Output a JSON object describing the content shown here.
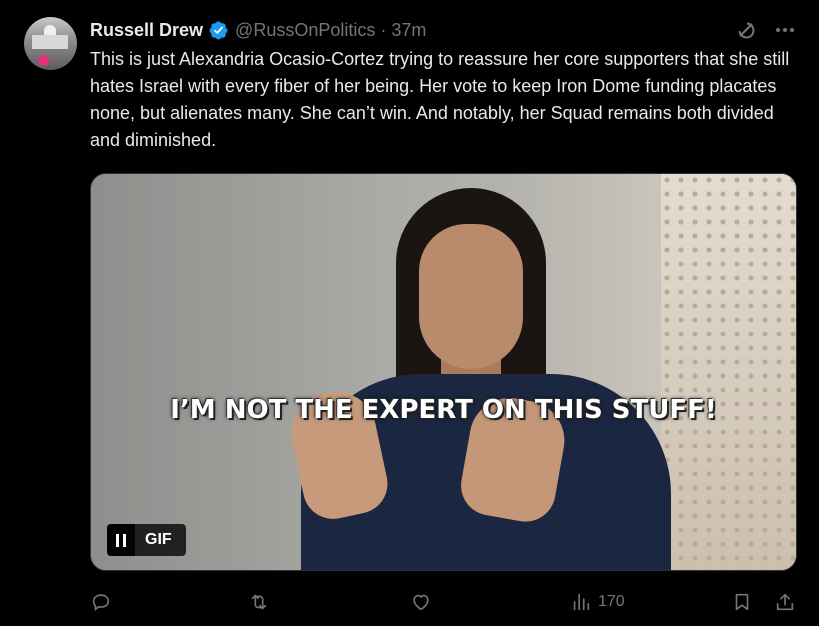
{
  "author": {
    "name": "Russell Drew",
    "handle": "@RussOnPolitics",
    "separator": "·",
    "time": "37m",
    "verified": true
  },
  "tweet": {
    "text": "This is just Alexandria Ocasio-Cortez trying to reassure her core supporters that she still hates Israel with every fiber of her being. Her vote to keep Iron Dome funding placates none, but alienates many. She can’t win. And notably, her Squad remains both divided and diminished."
  },
  "media": {
    "caption": "I’M NOT THE EXPERT ON THIS STUFF!",
    "gif_label": "GIF"
  },
  "actions": {
    "reply_count": "",
    "retweet_count": "",
    "like_count": "",
    "views_count": "170"
  },
  "colors": {
    "background": "#000000",
    "text_primary": "#e7e9ea",
    "text_secondary": "#71767b",
    "verified_badge": "#1d9bf0"
  },
  "icons": [
    "grok-icon",
    "more-icon",
    "verified-badge-icon",
    "pause-icon",
    "reply-icon",
    "retweet-icon",
    "like-icon",
    "views-icon",
    "bookmark-icon",
    "share-icon"
  ]
}
